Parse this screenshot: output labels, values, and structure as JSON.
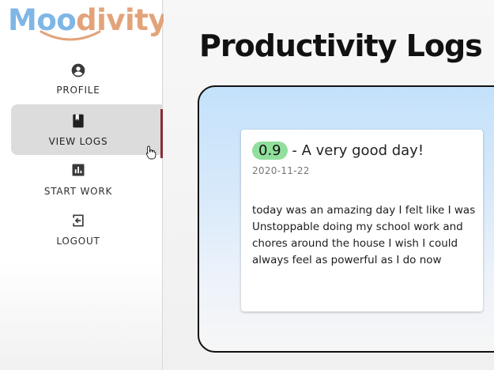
{
  "logo": {
    "part_a": "Moo",
    "part_b": "divity",
    "color_a": "#7fb6e6",
    "color_b": "#e3a37a"
  },
  "sidebar": {
    "items": [
      {
        "label": "PROFILE",
        "icon": "account-circle-icon",
        "active": false
      },
      {
        "label": "VIEW LOGS",
        "icon": "book-icon",
        "active": true
      },
      {
        "label": "START WORK",
        "icon": "bar-chart-icon",
        "active": false
      },
      {
        "label": "LOGOUT",
        "icon": "exit-icon",
        "active": false
      }
    ],
    "active_color": "#8a2a35"
  },
  "main": {
    "title": "Productivity Logs",
    "logs": [
      {
        "score": "0.9",
        "headline": "- A very good day!",
        "date": "2020-11-22",
        "body": "today was an amazing day I felt like I was Unstoppable doing my school work and chores around the house I wish I could always feel as powerful as I do now",
        "score_color": "#90df9c"
      }
    ]
  }
}
